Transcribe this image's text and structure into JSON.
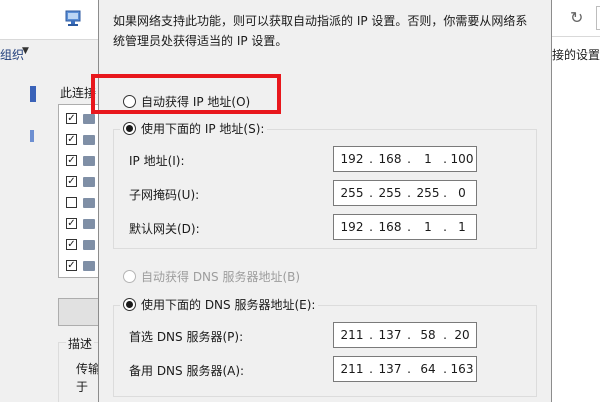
{
  "background_left": {
    "org_label": "组织",
    "conn_label": "此连接",
    "desc_label": "描述",
    "desc_line1": "传输",
    "desc_line2": "于"
  },
  "background_right": {
    "side_text": "接的设置"
  },
  "dialog": {
    "intro": "如果网络支持此功能，则可以获取自动指派的 IP 设置。否则，你需要从网络系统管理员处获得适当的 IP 设置。",
    "auto_ip_label": "自动获得 IP 地址(O)",
    "manual_ip_label": "使用下面的 IP 地址(S):",
    "ip_address_label": "IP 地址(I):",
    "subnet_label": "子网掩码(U):",
    "gateway_label": "默认网关(D):",
    "ip_address": [
      "192",
      "168",
      "1",
      "100"
    ],
    "subnet_mask": [
      "255",
      "255",
      "255",
      "0"
    ],
    "gateway": [
      "192",
      "168",
      "1",
      "1"
    ],
    "auto_dns_label": "自动获得 DNS 服务器地址(B)",
    "manual_dns_label": "使用下面的 DNS 服务器地址(E):",
    "preferred_dns_label": "首选 DNS 服务器(P):",
    "alternate_dns_label": "备用 DNS 服务器(A):",
    "preferred_dns": [
      "211",
      "137",
      "58",
      "20"
    ],
    "alternate_dns": [
      "211",
      "137",
      "64",
      "163"
    ]
  },
  "colors": {
    "highlight": "#e8171c",
    "dialog_bg": "#f0f0f0"
  },
  "icons": {
    "network": "network-adapter-icon",
    "refresh": "refresh-icon",
    "dropdown": "chevron-down-icon"
  }
}
